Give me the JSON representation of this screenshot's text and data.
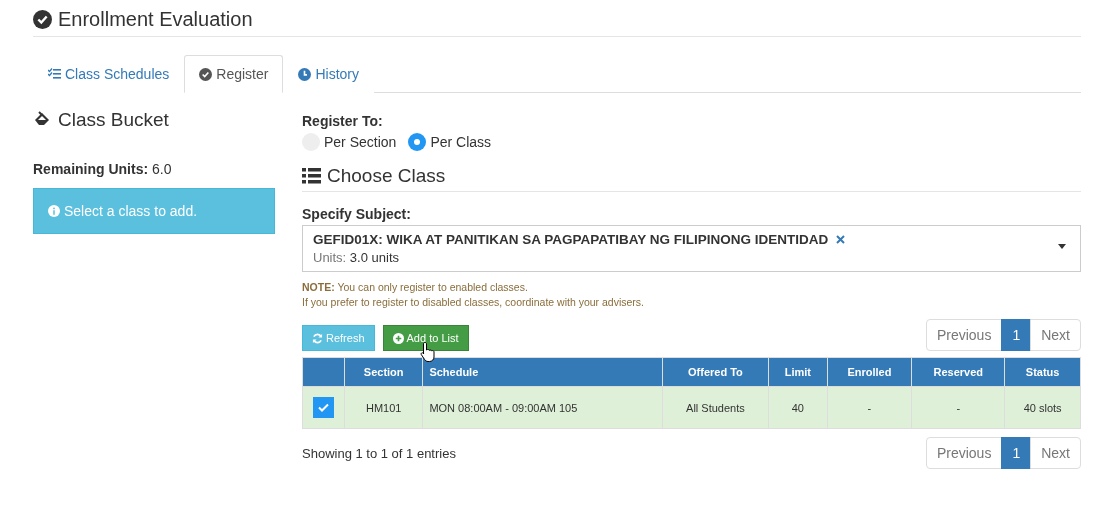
{
  "title": "Enrollment Evaluation",
  "tabs": [
    {
      "label": "Class Schedules",
      "kind": "list-check",
      "selected": false
    },
    {
      "label": "Register",
      "kind": "check",
      "selected": true
    },
    {
      "label": "History",
      "kind": "clock",
      "selected": false
    }
  ],
  "bucket": {
    "heading": "Class Bucket",
    "remaining_label": "Remaining Units:",
    "remaining_value": "6.0",
    "alert": "Select a class to add."
  },
  "register_to": {
    "label": "Register To:",
    "options": [
      {
        "label": "Per Section",
        "selected": false
      },
      {
        "label": "Per Class",
        "selected": true
      }
    ]
  },
  "choose_heading": "Choose Class",
  "subject": {
    "label": "Specify Subject:",
    "value": "GEFID01X: WIKA AT PANITIKAN SA PAGPAPATIBAY NG FILIPINONG IDENTIDAD",
    "units_label": "Units:",
    "units_value": "3.0 units"
  },
  "note": {
    "text": "**NOTE:** You can only register to enabled classes.",
    "text_2": "If you prefer to register to disabled classes, coordinate with your advisers."
  },
  "buttons": [
    "Refresh",
    "Add to List"
  ],
  "pagination_top": [
    {
      "label": "Previous",
      "selected": false
    },
    {
      "label": "1",
      "selected": true
    },
    {
      "label": "Next",
      "selected": false
    }
  ],
  "table": {
    "columns": [
      "Section",
      "Schedule",
      "Offered To",
      "Limit",
      "Enrolled",
      "Reserved",
      "Status"
    ],
    "rows": [
      {
        "checked": true,
        "cells": [
          "HM101",
          "MON 08:00AM - 09:00AM 105",
          "All Students",
          "40",
          "-",
          "-",
          "40 slots"
        ]
      }
    ]
  },
  "footer": "Showing 1 to 1 of 1 entries",
  "pagination_bottom": [
    {
      "label": "Previous",
      "selected": false
    },
    {
      "label": "1",
      "selected": true
    },
    {
      "label": "Next",
      "selected": false
    }
  ]
}
